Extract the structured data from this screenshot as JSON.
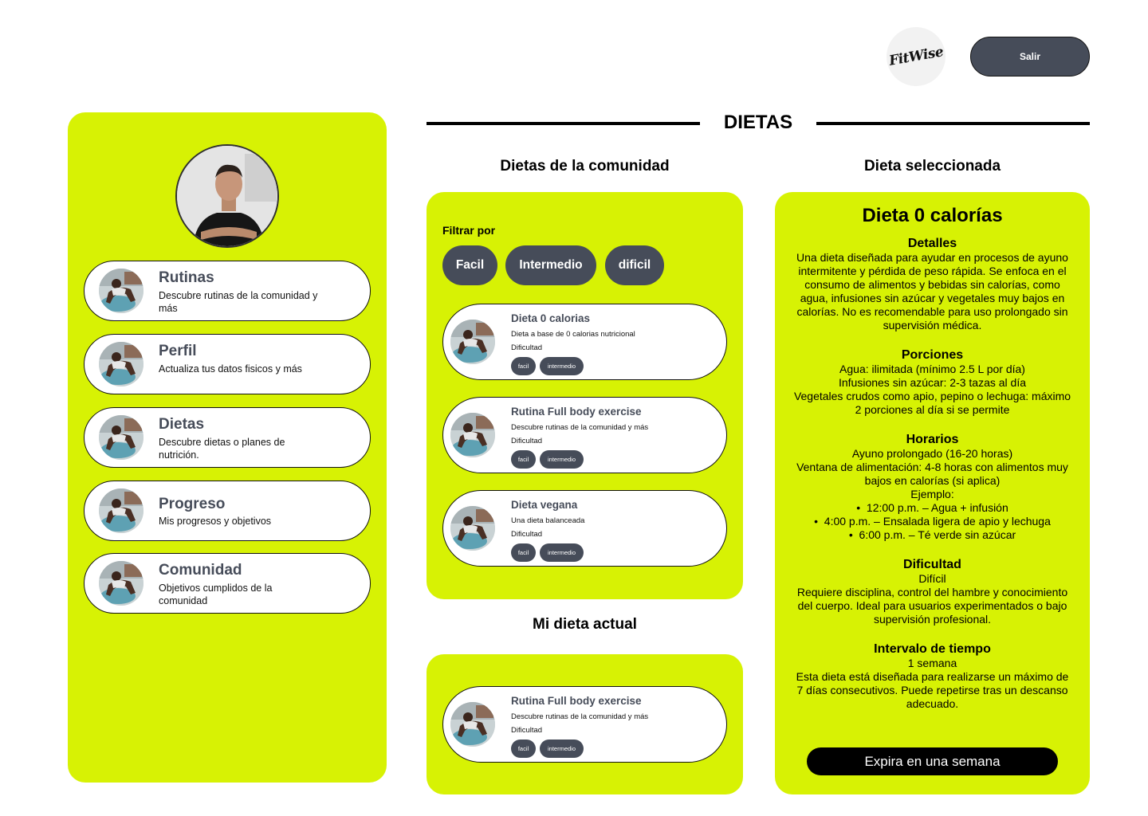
{
  "header": {
    "logo_text": "FitWise",
    "logout_label": "Salir"
  },
  "sidebar": {
    "items": [
      {
        "title": "Rutinas",
        "desc": "Descubre rutinas de la comunidad y más"
      },
      {
        "title": "Perfil",
        "desc": "Actualiza tus datos fisicos y más"
      },
      {
        "title": "Dietas",
        "desc": "Descubre dietas o planes de nutrición."
      },
      {
        "title": "Progreso",
        "desc": "Mis progresos y objetivos"
      },
      {
        "title": "Comunidad",
        "desc": "Objetivos cumplidos de la comunidad"
      }
    ]
  },
  "page": {
    "title": "DIETAS"
  },
  "community": {
    "title": "Dietas  de la comunidad",
    "filter_label": "Filtrar por",
    "filters": [
      "Facil",
      "Intermedio",
      "dificil"
    ],
    "cards": [
      {
        "title": "Dieta 0 calorias",
        "desc": "Dieta a base de  0 calorias nutricional",
        "difficulty_label": "Dificultad",
        "tags": [
          "facil",
          "intermedio"
        ]
      },
      {
        "title": "Rutina Full body exercise",
        "desc": "Descubre rutinas de la comunidad y más",
        "difficulty_label": "Dificultad",
        "tags": [
          "facil",
          "intermedio"
        ]
      },
      {
        "title": "Dieta vegana",
        "desc": "Una dieta balanceada",
        "difficulty_label": "Dificultad",
        "tags": [
          "facil",
          "intermedio"
        ]
      }
    ]
  },
  "current": {
    "title": "Mi dieta actual",
    "card": {
      "title": "Rutina Full body exercise",
      "desc": "Descubre rutinas de la comunidad y más",
      "difficulty_label": "Dificultad",
      "tags": [
        "facil",
        "intermedio"
      ]
    }
  },
  "selected": {
    "section_title": "Dieta seleccionada",
    "name": "Dieta 0 calorías",
    "details_heading": "Detalles",
    "details_text": "Una dieta diseñada para ayudar en procesos de ayuno intermitente y pérdida de peso rápida. Se enfoca en el consumo de alimentos y bebidas sin calorías, como agua, infusiones sin azúcar y vegetales muy bajos en calorías. No es recomendable para uso prolongado sin supervisión médica.",
    "portions_heading": "Porciones",
    "portions": [
      "Agua: ilimitada (mínimo 2.5 L por día)",
      "Infusiones sin azúcar: 2-3 tazas al día",
      "Vegetales crudos como apio, pepino o lechuga: máximo 2 porciones al día si se permite"
    ],
    "schedule_heading": "Horarios",
    "schedule_lines": [
      "Ayuno prolongado (16-20 horas)",
      "Ventana de alimentación: 4-8 horas con alimentos muy bajos en calorías (si aplica)",
      "Ejemplo:"
    ],
    "schedule_items": [
      "12:00 p.m. – Agua + infusión",
      "4:00 p.m. – Ensalada ligera de apio y lechuga",
      "6:00 p.m. – Té verde sin azúcar"
    ],
    "difficulty_heading": "Dificultad",
    "difficulty_value": "Difícil",
    "difficulty_text": "Requiere disciplina, control del hambre y conocimiento del cuerpo. Ideal para usuarios experimentados o bajo supervisión profesional.",
    "interval_heading": "Intervalo de tiempo",
    "interval_value": "1 semana",
    "interval_text": "Esta dieta está diseñada para realizarse un máximo de 7 días consecutivos. Puede repetirse tras un descanso adecuado.",
    "expire_label": "Expira en una semana"
  },
  "colors": {
    "accent": "#d7f204",
    "dark": "#464c59"
  }
}
